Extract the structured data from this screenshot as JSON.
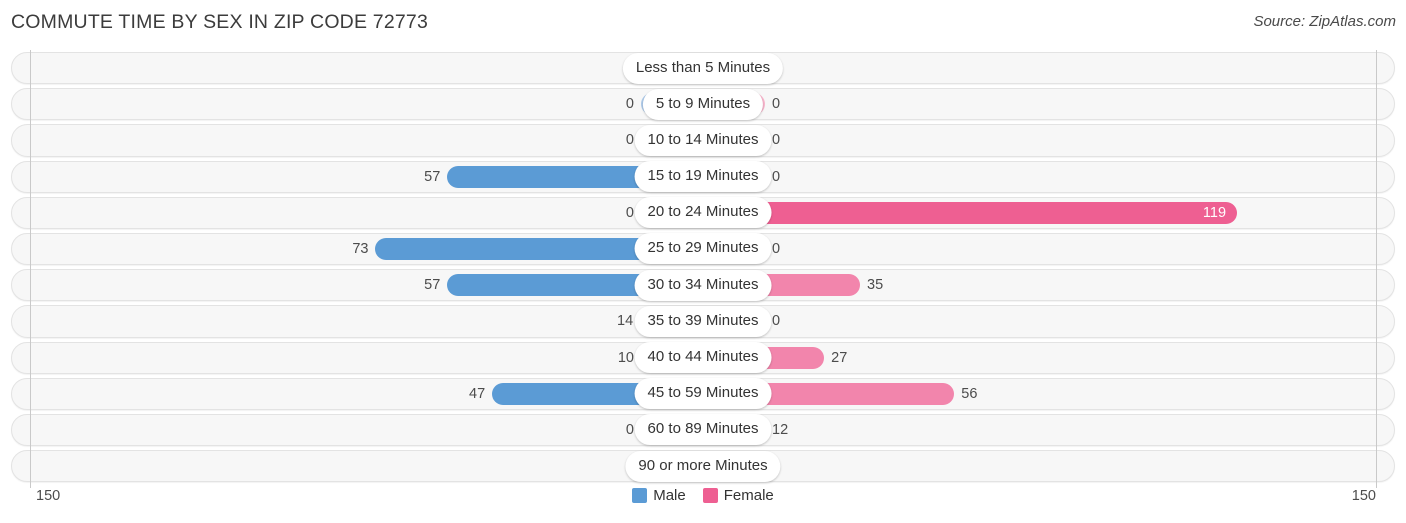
{
  "header": {
    "title": "COMMUTE TIME BY SEX IN ZIP CODE 72773",
    "source": "Source: ZipAtlas.com"
  },
  "legend": {
    "male_label": "Male",
    "female_label": "Female",
    "male_color": "#5b9bd5",
    "female_color": "#ee5f92"
  },
  "axis": {
    "left_max": "150",
    "right_max": "150"
  },
  "colors": {
    "male_strong": "#5b9bd5",
    "male_light": "#aecbeb",
    "female_strong": "#ee5f92",
    "female_mid": "#f285ac",
    "female_light": "#f9b6cd",
    "track_bg": "#f7f7f7",
    "track_border": "#e3e3e3"
  },
  "chart_data": {
    "type": "bar",
    "subtype": "diverging-bidirectional",
    "title": "COMMUTE TIME BY SEX IN ZIP CODE 72773",
    "xlabel": "",
    "ylabel": "",
    "axis_max": 150,
    "xlim": [
      150,
      150
    ],
    "grid": false,
    "legend_position": "bottom-center",
    "categories": [
      "Less than 5 Minutes",
      "5 to 9 Minutes",
      "10 to 14 Minutes",
      "15 to 19 Minutes",
      "20 to 24 Minutes",
      "25 to 29 Minutes",
      "30 to 34 Minutes",
      "35 to 39 Minutes",
      "40 to 44 Minutes",
      "45 to 59 Minutes",
      "60 to 89 Minutes",
      "90 or more Minutes"
    ],
    "series": [
      {
        "name": "Male",
        "direction": "left",
        "values": [
          0,
          0,
          0,
          57,
          0,
          73,
          57,
          14,
          10,
          47,
          0,
          0
        ]
      },
      {
        "name": "Female",
        "direction": "right",
        "values": [
          0,
          0,
          0,
          0,
          119,
          0,
          35,
          0,
          27,
          56,
          12,
          0
        ]
      }
    ]
  },
  "rows": [
    {
      "label": "Less than 5 Minutes",
      "male": "0",
      "female": "0"
    },
    {
      "label": "5 to 9 Minutes",
      "male": "0",
      "female": "0"
    },
    {
      "label": "10 to 14 Minutes",
      "male": "0",
      "female": "0"
    },
    {
      "label": "15 to 19 Minutes",
      "male": "57",
      "female": "0"
    },
    {
      "label": "20 to 24 Minutes",
      "male": "0",
      "female": "119"
    },
    {
      "label": "25 to 29 Minutes",
      "male": "73",
      "female": "0"
    },
    {
      "label": "30 to 34 Minutes",
      "male": "57",
      "female": "35"
    },
    {
      "label": "35 to 39 Minutes",
      "male": "14",
      "female": "0"
    },
    {
      "label": "40 to 44 Minutes",
      "male": "10",
      "female": "27"
    },
    {
      "label": "45 to 59 Minutes",
      "male": "47",
      "female": "56"
    },
    {
      "label": "60 to 89 Minutes",
      "male": "0",
      "female": "12"
    },
    {
      "label": "90 or more Minutes",
      "male": "0",
      "female": "0"
    }
  ]
}
